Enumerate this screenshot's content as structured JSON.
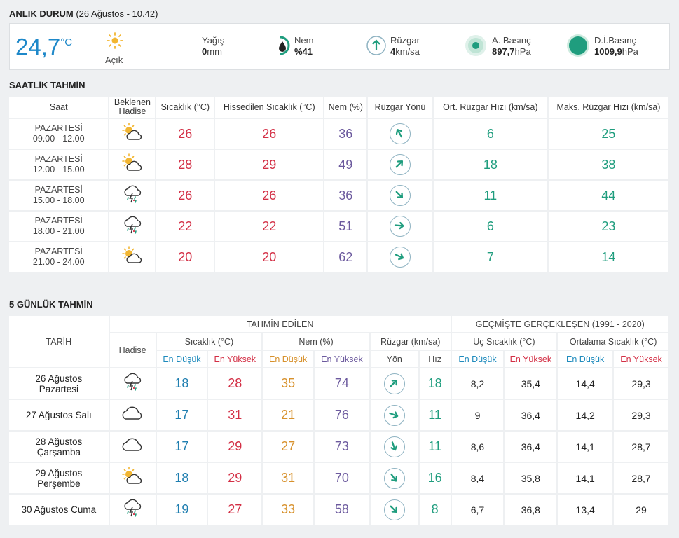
{
  "current": {
    "section_title": "ANLIK DURUM",
    "section_sub": "(26 Ağustos - 10.42)",
    "temperature": "24,7",
    "temp_unit": "°C",
    "condition": "Açık",
    "precip_label": "Yağış",
    "precip_value": "0",
    "precip_unit": "mm",
    "humidity_label": "Nem",
    "humidity_value": "%41",
    "wind_label": "Rüzgar",
    "wind_value": "4",
    "wind_unit": "km/sa",
    "pressure_label": "A. Basınç",
    "pressure_value": "897,7",
    "pressure_unit": "hPa",
    "sea_pressure_label": "D.İ.Basınç",
    "sea_pressure_value": "1009,9",
    "sea_pressure_unit": "hPa"
  },
  "hourly": {
    "section_title": "SAATLİK TAHMİN",
    "headers": [
      "Saat",
      "Beklenen Hadise",
      "Sıcaklık (°C)",
      "Hissedilen Sıcaklık (°C)",
      "Nem (%)",
      "Rüzgar Yönü",
      "Ort. Rüzgar Hızı (km/sa)",
      "Maks. Rüzgar Hızı (km/sa)"
    ],
    "rows": [
      {
        "day": "PAZARTESİ",
        "time": "09.00 - 12.00",
        "icon": "sun-cloud-icon",
        "temp": "26",
        "feels": "26",
        "humidity": "36",
        "wind_dir_deg": -30,
        "avg_wind": "6",
        "max_wind": "25"
      },
      {
        "day": "PAZARTESİ",
        "time": "12.00 - 15.00",
        "icon": "sun-cloud-icon",
        "temp": "28",
        "feels": "29",
        "humidity": "49",
        "wind_dir_deg": 45,
        "avg_wind": "18",
        "max_wind": "38"
      },
      {
        "day": "PAZARTESİ",
        "time": "15.00 - 18.00",
        "icon": "thunderstorm-icon",
        "temp": "26",
        "feels": "26",
        "humidity": "36",
        "wind_dir_deg": 135,
        "avg_wind": "11",
        "max_wind": "44"
      },
      {
        "day": "PAZARTESİ",
        "time": "18.00 - 21.00",
        "icon": "thunderstorm-icon",
        "temp": "22",
        "feels": "22",
        "humidity": "51",
        "wind_dir_deg": 95,
        "avg_wind": "6",
        "max_wind": "23"
      },
      {
        "day": "PAZARTESİ",
        "time": "21.00 - 24.00",
        "icon": "sun-cloud-icon",
        "temp": "20",
        "feels": "20",
        "humidity": "62",
        "wind_dir_deg": 115,
        "avg_wind": "7",
        "max_wind": "14"
      }
    ]
  },
  "daily": {
    "section_title": "5 GÜNLÜK TAHMİN",
    "h_date": "TARİH",
    "h_forecast": "TAHMİN EDİLEN",
    "h_history": "GEÇMİŞTE GERÇEKLEŞEN (1991 - 2020)",
    "h_event": "Hadise",
    "h_temp": "Sıcaklık (°C)",
    "h_hum": "Nem (%)",
    "h_wind": "Rüzgar (km/sa)",
    "h_extreme": "Uç Sıcaklık (°C)",
    "h_avg": "Ortalama Sıcaklık (°C)",
    "h_low": "En Düşük",
    "h_high": "En Yüksek",
    "h_dir": "Yön",
    "h_speed": "Hız",
    "rows": [
      {
        "date": "26 Ağustos",
        "weekday": "Pazartesi",
        "icon": "thunderstorm-icon",
        "tmin": "18",
        "tmax": "28",
        "hmin": "35",
        "hmax": "74",
        "wind_dir_deg": 45,
        "wind": "18",
        "ext_min": "8,2",
        "ext_max": "35,4",
        "avg_min": "14,4",
        "avg_max": "29,3"
      },
      {
        "date": "27 Ağustos Salı",
        "weekday": "",
        "icon": "cloud-icon",
        "tmin": "17",
        "tmax": "31",
        "hmin": "21",
        "hmax": "76",
        "wind_dir_deg": 110,
        "wind": "11",
        "ext_min": "9",
        "ext_max": "36,4",
        "avg_min": "14,2",
        "avg_max": "29,3"
      },
      {
        "date": "28 Ağustos",
        "weekday": "Çarşamba",
        "icon": "cloud-icon",
        "tmin": "17",
        "tmax": "29",
        "hmin": "27",
        "hmax": "73",
        "wind_dir_deg": 160,
        "wind": "11",
        "ext_min": "8,6",
        "ext_max": "36,4",
        "avg_min": "14,1",
        "avg_max": "28,7"
      },
      {
        "date": "29 Ağustos",
        "weekday": "Perşembe",
        "icon": "sun-cloud-icon",
        "tmin": "18",
        "tmax": "29",
        "hmin": "31",
        "hmax": "70",
        "wind_dir_deg": 145,
        "wind": "16",
        "ext_min": "8,4",
        "ext_max": "35,8",
        "avg_min": "14,1",
        "avg_max": "28,7"
      },
      {
        "date": "30 Ağustos Cuma",
        "weekday": "",
        "icon": "thunderstorm-icon",
        "tmin": "19",
        "tmax": "27",
        "hmin": "33",
        "hmax": "58",
        "wind_dir_deg": 135,
        "wind": "8",
        "ext_min": "6,7",
        "ext_max": "36,8",
        "avg_min": "13,4",
        "avg_max": "29"
      }
    ]
  }
}
